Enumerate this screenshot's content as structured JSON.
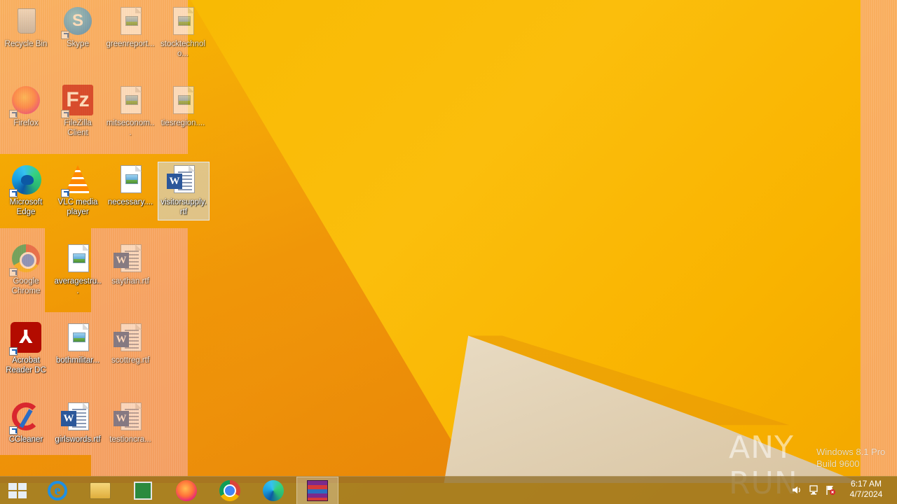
{
  "desktop": {
    "icons": [
      {
        "id": "recycle-bin",
        "label": "Recycle Bin",
        "icon": "recycle-bin-icon"
      },
      {
        "id": "skype",
        "label": "Skype",
        "icon": "skype-icon"
      },
      {
        "id": "greenreport",
        "label": "greenreport...",
        "icon": "image-document-icon"
      },
      {
        "id": "stocktechnolo",
        "label": "stocktechnolo...",
        "icon": "image-document-icon"
      },
      {
        "id": "firefox",
        "label": "Firefox",
        "icon": "firefox-icon"
      },
      {
        "id": "filezilla",
        "label": "FileZilla Client",
        "icon": "filezilla-icon"
      },
      {
        "id": "mitseconomic",
        "label": "mitseconom...",
        "icon": "image-document-icon"
      },
      {
        "id": "tiesregion",
        "label": "tiesregion....",
        "icon": "image-document-icon"
      },
      {
        "id": "edge",
        "label": "Microsoft Edge",
        "icon": "edge-icon"
      },
      {
        "id": "vlc",
        "label": "VLC media player",
        "icon": "vlc-icon"
      },
      {
        "id": "necessary",
        "label": "necessary....",
        "icon": "image-document-icon"
      },
      {
        "id": "visitorsupply",
        "label": "visitorsupply.rtf",
        "icon": "word-document-icon"
      },
      {
        "id": "chrome",
        "label": "Google Chrome",
        "icon": "chrome-icon"
      },
      {
        "id": "averagestru",
        "label": "averagestru...",
        "icon": "image-document-icon"
      },
      {
        "id": "saythan",
        "label": "saythan.rtf",
        "icon": "word-document-icon"
      },
      {
        "id": "acrobat",
        "label": "Acrobat Reader DC",
        "icon": "acrobat-icon"
      },
      {
        "id": "bothmilitar",
        "label": "bothmilitar...",
        "icon": "image-document-icon"
      },
      {
        "id": "scottreg",
        "label": "scottreg.rtf",
        "icon": "word-document-icon"
      },
      {
        "id": "ccleaner",
        "label": "CCleaner",
        "icon": "ccleaner-icon"
      },
      {
        "id": "girlswords",
        "label": "girlswords.rtf",
        "icon": "word-document-icon"
      },
      {
        "id": "testioncra",
        "label": "testioncra...",
        "icon": "word-document-icon"
      }
    ],
    "selected_icon": "visitorsupply.rtf"
  },
  "watermark": {
    "brand": "ANY RUN",
    "os_line1": "Windows 8.1 Pro",
    "os_line2": "Build 9600"
  },
  "taskbar": {
    "start": "Start",
    "pinned": [
      {
        "name": "Internet Explorer",
        "icon": "internet-explorer-icon"
      },
      {
        "name": "File Explorer",
        "icon": "file-explorer-icon"
      },
      {
        "name": "Store",
        "icon": "store-icon"
      },
      {
        "name": "Firefox",
        "icon": "firefox-icon"
      },
      {
        "name": "Google Chrome",
        "icon": "chrome-icon"
      },
      {
        "name": "Microsoft Edge",
        "icon": "edge-icon"
      },
      {
        "name": "WinRAR",
        "icon": "winrar-icon",
        "active": true
      }
    ],
    "tray": {
      "icons": [
        "volume-icon",
        "network-icon",
        "action-center-flag-icon"
      ],
      "time": "6:17 AM",
      "date": "4/7/2024"
    }
  }
}
